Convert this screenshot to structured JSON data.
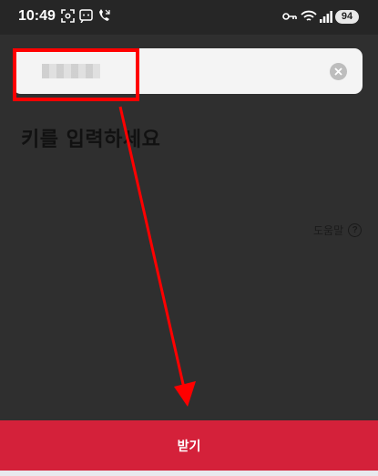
{
  "status_bar": {
    "time": "10:49",
    "battery": "94",
    "left_icons": [
      "screenshot-icon",
      "message-icon",
      "call-icon"
    ],
    "right_icons": [
      "key-icon",
      "wifi-icon",
      "signal-icon",
      "battery-icon"
    ]
  },
  "key_input": {
    "value": "",
    "masked": true,
    "clear_icon": "clear-icon"
  },
  "page": {
    "title": "키를 입력하세요",
    "help_label": "도움말",
    "help_icon": "question-circle-icon"
  },
  "actions": {
    "receive_label": "받기"
  },
  "colors": {
    "background": "#2f2f2f",
    "button": "#d4213a",
    "annotation": "#ff0000"
  }
}
